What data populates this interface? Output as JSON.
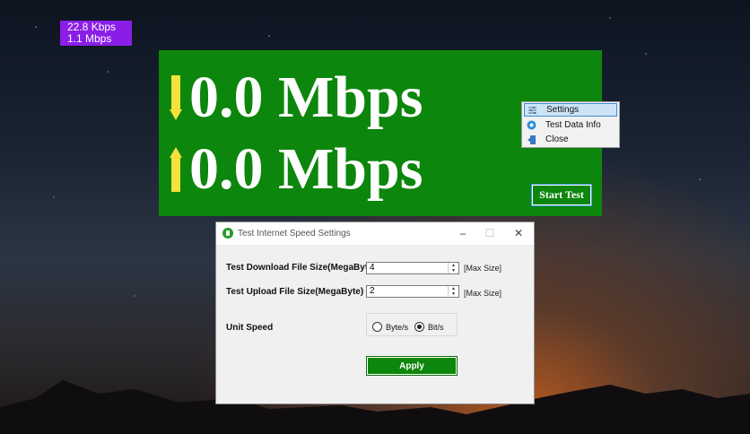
{
  "speed_badge": {
    "download": "22.8 Kbps",
    "upload": "1.1 Mbps"
  },
  "meter": {
    "download_value": "0.0 Mbps",
    "upload_value": "0.0 Mbps",
    "start_button": "Start Test"
  },
  "context_menu": {
    "items": [
      {
        "label": "Settings",
        "icon": "sliders-icon"
      },
      {
        "label": "Test Data Info",
        "icon": "info-icon"
      },
      {
        "label": "Close",
        "icon": "exit-icon"
      }
    ]
  },
  "dialog": {
    "title": "Test Internet Speed Settings",
    "download_label": "Test Download File Size(MegaByte)",
    "download_value": "4",
    "download_hint": "[Max Size]",
    "upload_label": "Test Upload File Size(MegaByte)",
    "upload_value": "2",
    "upload_hint": "[Max Size]",
    "unit_label": "Unit Speed",
    "unit_options": [
      "Byte/s",
      "Bit/s"
    ],
    "unit_selected": "Bit/s",
    "apply_button": "Apply"
  },
  "colors": {
    "meter_bg": "#0c860c",
    "badge_bg": "#8a1ee8",
    "arrow": "#f5e23a"
  }
}
